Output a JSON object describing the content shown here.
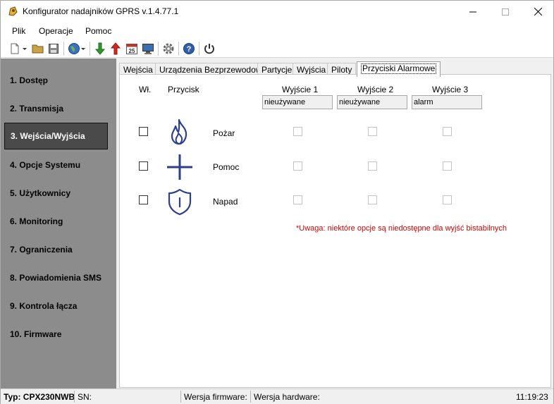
{
  "window": {
    "title": "Konfigurator nadajników GPRS v.1.4.77.1"
  },
  "menu": [
    "Plik",
    "Operacje",
    "Pomoc"
  ],
  "toolbar": {
    "icons": [
      "new-file-icon",
      "open-folder-icon",
      "save-icon",
      "globe-icon",
      "download-arrow-icon",
      "upload-arrow-icon",
      "calendar-icon",
      "monitor-icon",
      "gear-icon",
      "help-icon",
      "power-icon"
    ],
    "calendar_day": "25"
  },
  "sidebar": {
    "items": [
      {
        "label": "1. Dostęp"
      },
      {
        "label": "2. Transmisja"
      },
      {
        "label": "3. Wejścia/Wyjścia"
      },
      {
        "label": "4. Opcje Systemu"
      },
      {
        "label": "5. Użytkownicy"
      },
      {
        "label": "6. Monitoring"
      },
      {
        "label": "7. Ograniczenia"
      },
      {
        "label": "8. Powiadomienia SMS"
      },
      {
        "label": "9. Kontrola łącza"
      },
      {
        "label": "10. Firmware"
      }
    ],
    "active_index": 2
  },
  "tabs": [
    {
      "label": "Wejścia"
    },
    {
      "label": "Urządzenia Bezprzewodowe"
    },
    {
      "label": "Partycje"
    },
    {
      "label": "Wyjścia"
    },
    {
      "label": "Piloty"
    },
    {
      "label": "Przyciski Alarmowe"
    }
  ],
  "active_tab": 5,
  "panel": {
    "col_enabled": "Wł.",
    "col_button": "Przycisk",
    "outputs": [
      {
        "header": "Wyjście 1",
        "value": "nieużywane"
      },
      {
        "header": "Wyjście 2",
        "value": "nieużywane"
      },
      {
        "header": "Wyjście 3",
        "value": "alarm"
      }
    ],
    "rows": [
      {
        "label": "Pożar",
        "icon": "fire-icon",
        "enabled": false,
        "outputs": [
          false,
          false,
          false
        ]
      },
      {
        "label": "Pomoc",
        "icon": "plus-icon",
        "enabled": false,
        "outputs": [
          false,
          false,
          false
        ]
      },
      {
        "label": "Napad",
        "icon": "shield-icon",
        "enabled": false,
        "outputs": [
          false,
          false,
          false
        ]
      }
    ],
    "warning": "*Uwaga: niektóre opcje są niedostępne dla wyjść bistabilnych"
  },
  "statusbar": {
    "type_label": "Typ: CPX230NWB",
    "sn_label": "SN:",
    "firmware_label": "Wersja firmware:",
    "hardware_label": "Wersja hardware:",
    "time": "11:19:23"
  },
  "colors": {
    "icon_blue": "#2b3f8c",
    "warning_red": "#d20000",
    "sidebar_bg": "#8c8c8c",
    "active_nav_bg": "#4a4a4a"
  }
}
